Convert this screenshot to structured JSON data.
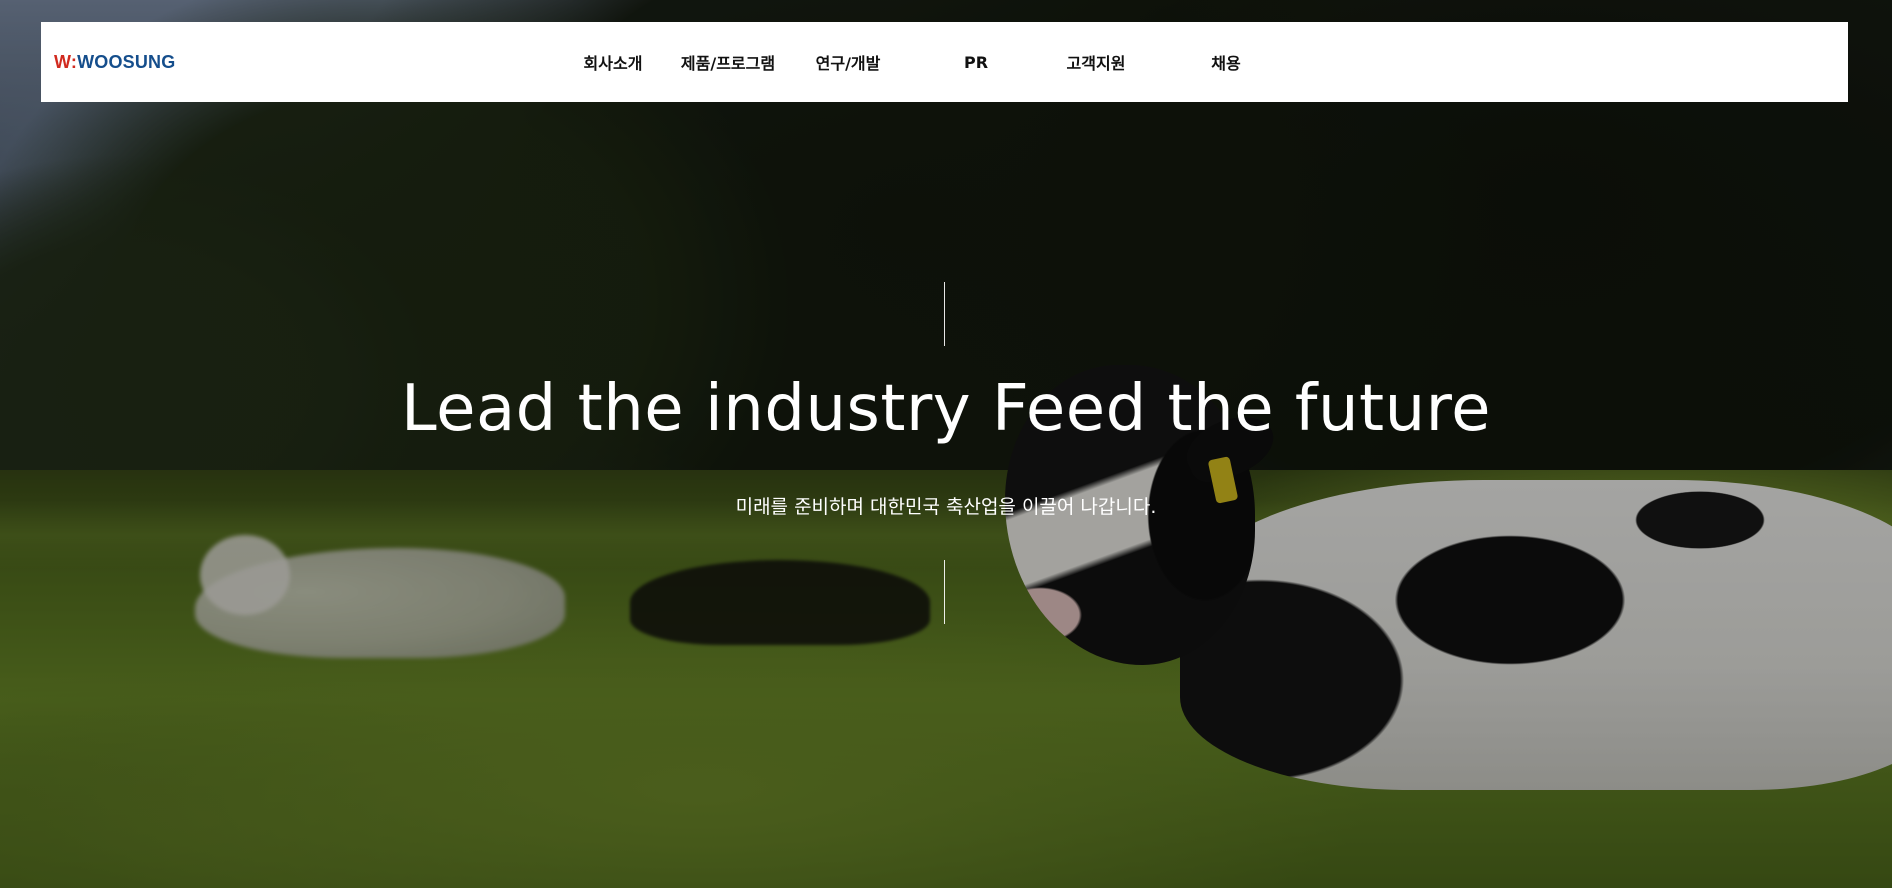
{
  "header": {
    "logo": {
      "prefix": "W:",
      "name": "WOOSUNG"
    },
    "nav": [
      {
        "label": "회사소개"
      },
      {
        "label": "제품/프로그램"
      },
      {
        "label": "연구/개발"
      },
      {
        "label": "PR"
      },
      {
        "label": "고객지원"
      },
      {
        "label": "채용"
      }
    ]
  },
  "hero": {
    "title": "Lead the industry Feed the future",
    "subtitle": "미래를 준비하며 대한민국 축산업을 이끌어 나갑니다.",
    "background_image": "cows-lying-on-grass-field"
  },
  "colors": {
    "logo_accent": "#d12a1f",
    "logo_primary": "#154e8c",
    "header_bg": "#ffffff",
    "nav_text": "#111111",
    "hero_text": "#ffffff"
  }
}
